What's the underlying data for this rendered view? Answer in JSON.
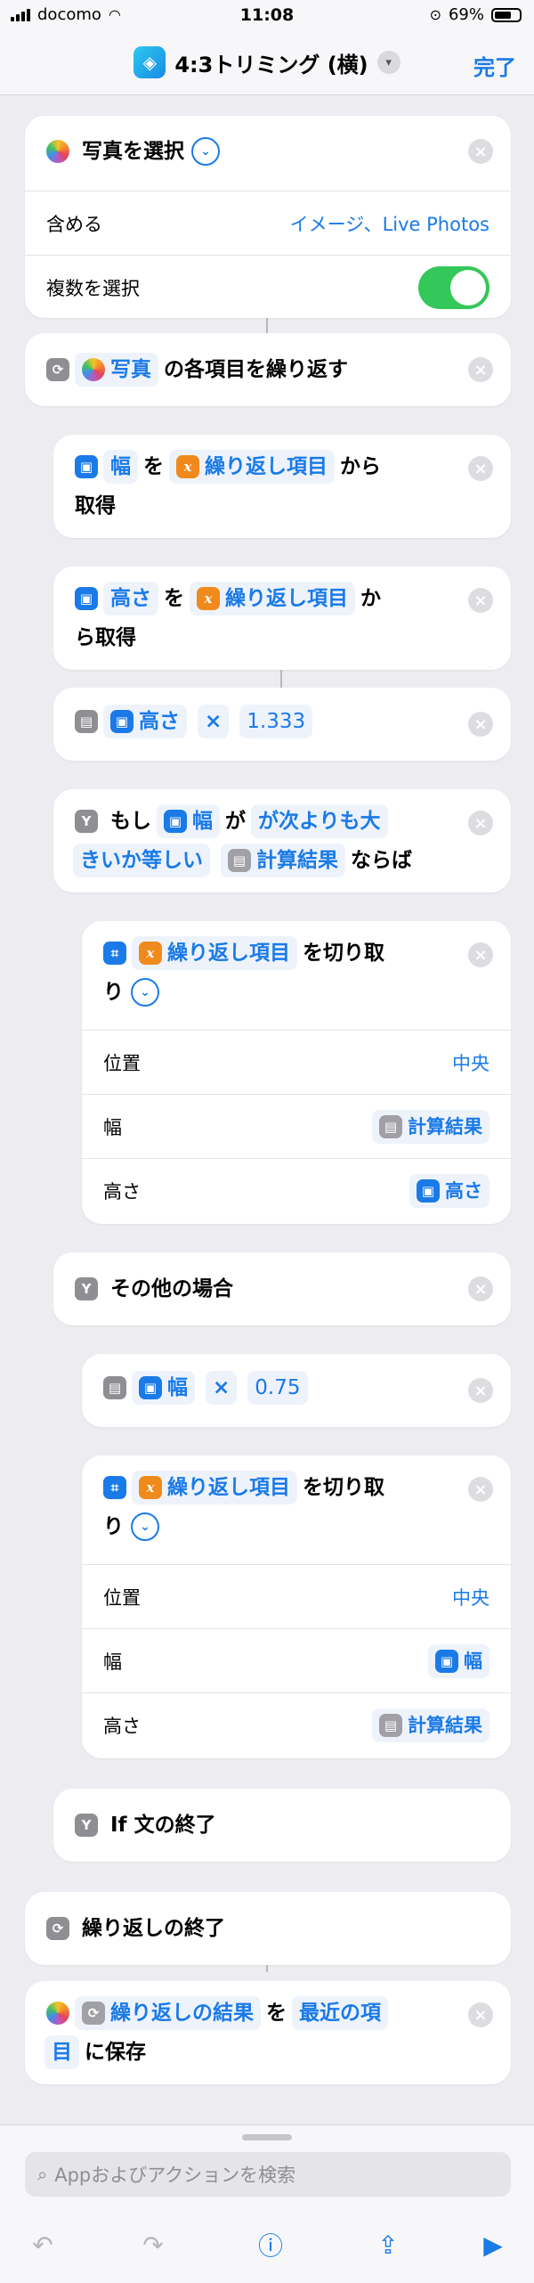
{
  "status_bar": {
    "carrier": "docomo",
    "time": "11:08",
    "battery": "69%",
    "battery_level": 0.69
  },
  "nav": {
    "title": "4:3トリミング (横)",
    "done": "完了"
  },
  "select_photos": {
    "title": "写真を選択",
    "include_label": "含める",
    "include_value": "イメージ、Live Photos",
    "multiple_label": "複数を選択",
    "multiple_on": true
  },
  "repeat": {
    "var": "写真",
    "text": "の各項目を繰り返す"
  },
  "get_width": {
    "prop": "幅",
    "wo": "を",
    "var": "繰り返し項目",
    "tail1": "から",
    "tail2": "取得"
  },
  "get_height": {
    "prop": "高さ",
    "wo": "を",
    "var": "繰り返し項目",
    "tail1": "か",
    "tail2": "ら取得"
  },
  "calc1": {
    "var": "高さ",
    "op": "×",
    "num": "1.333"
  },
  "if_block": {
    "moshi": "もし",
    "var": "幅",
    "ga": "が",
    "cond1": "が次よりも大",
    "cond2": "きいか等しい",
    "calc": "計算結果",
    "naraba": "ならば"
  },
  "crop1": {
    "var": "繰り返し項目",
    "wo": "を切り取",
    "ri": "り",
    "pos_label": "位置",
    "pos_value": "中央",
    "width_label": "幅",
    "width_value": "計算結果",
    "height_label": "高さ",
    "height_value": "高さ"
  },
  "otherwise": {
    "text": "その他の場合"
  },
  "calc2": {
    "var": "幅",
    "op": "×",
    "num": "0.75"
  },
  "crop2": {
    "var": "繰り返し項目",
    "wo": "を切り取",
    "ri": "り",
    "pos_label": "位置",
    "pos_value": "中央",
    "width_label": "幅",
    "width_value": "幅",
    "height_label": "高さ",
    "height_value": "計算結果"
  },
  "end_if": {
    "text": "If 文の終了"
  },
  "end_repeat": {
    "text": "繰り返しの終了"
  },
  "save": {
    "var": "繰り返しの結果",
    "wo": "を",
    "album1": "最近の項",
    "album2": "目",
    "tail": "に保存"
  },
  "search": {
    "placeholder": "Appおよびアクションを検索"
  }
}
